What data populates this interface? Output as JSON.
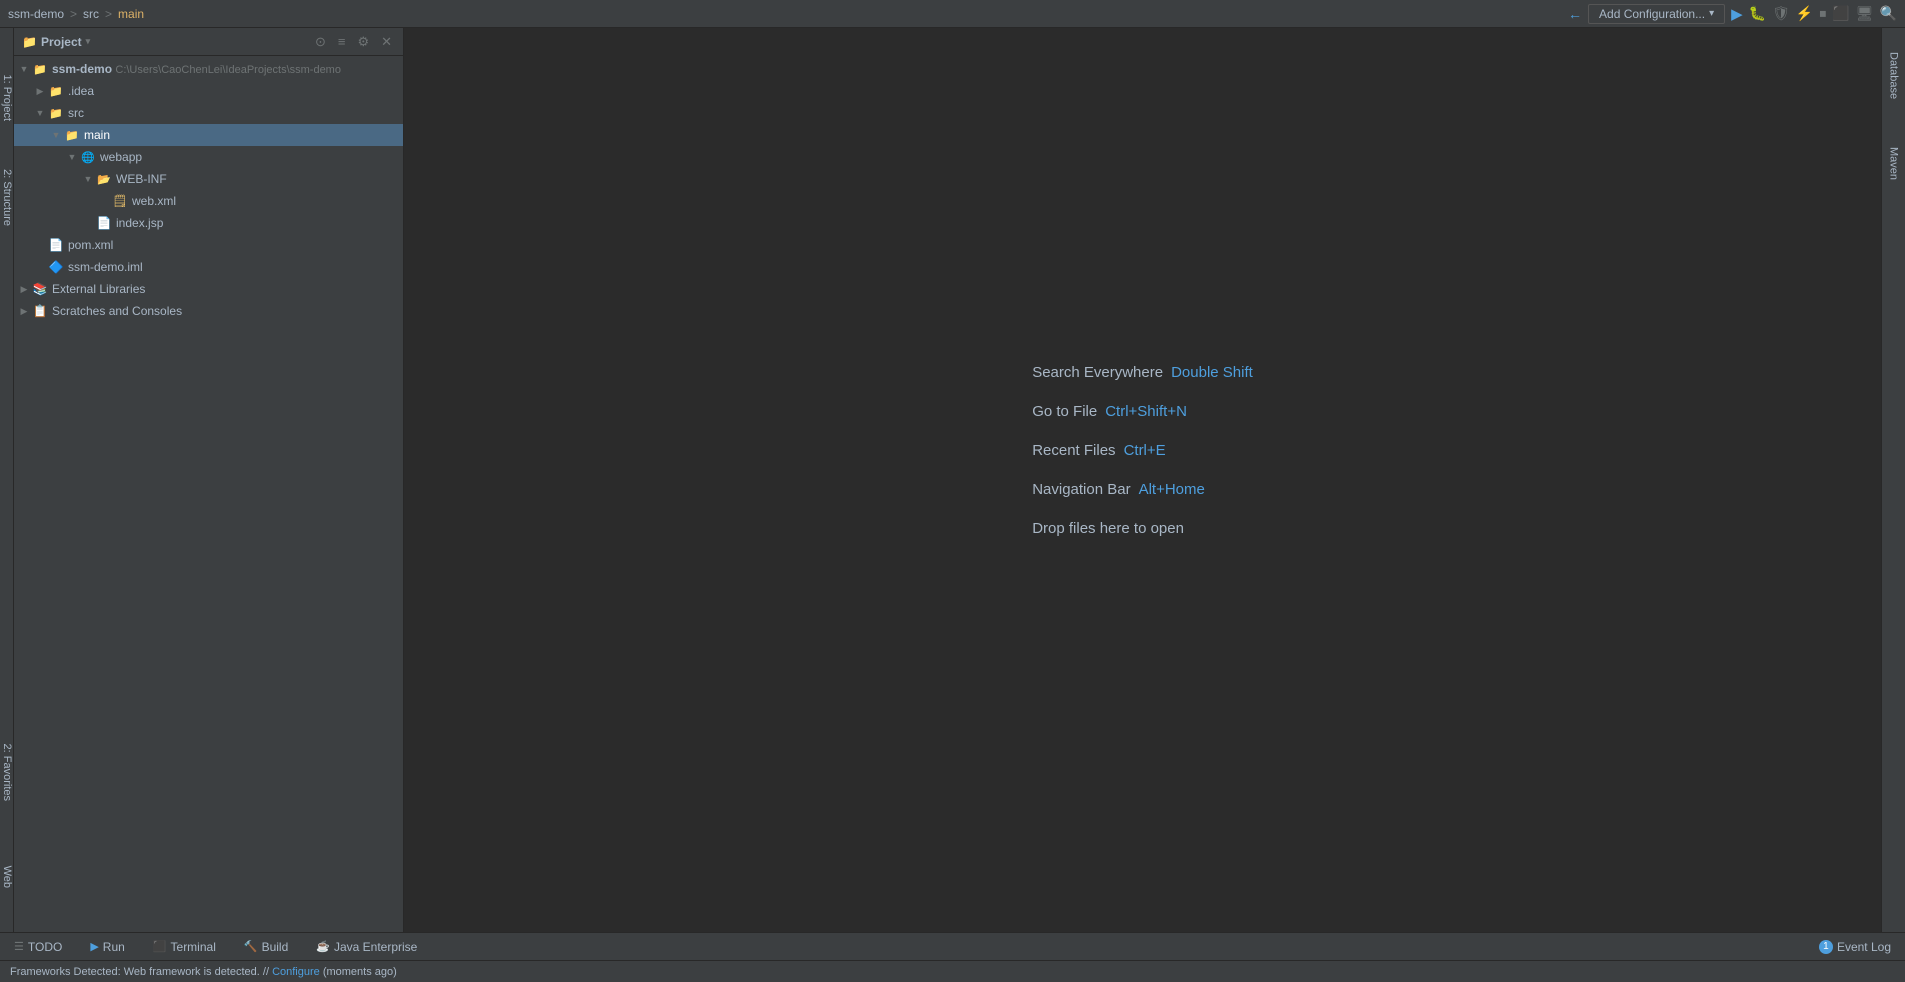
{
  "topbar": {
    "breadcrumb": {
      "project": "ssm-demo",
      "sep1": ">",
      "src": "src",
      "sep2": ">",
      "main": "main"
    },
    "addConfig": "Add Configuration...",
    "run_tooltip": "Run",
    "debug_tooltip": "Debug"
  },
  "sidebar": {
    "title": "Project",
    "leftTabs": [
      {
        "label": "1: Project",
        "id": "project-tab"
      },
      {
        "label": "2: Structure",
        "id": "structure-tab"
      },
      {
        "label": "2: Favorites",
        "id": "favorites-tab"
      }
    ],
    "tree": [
      {
        "id": "ssm-demo",
        "label": "ssm-demo",
        "path": "C:\\Users\\CaoChenLei\\IdeaProjects\\ssm-demo",
        "indent": 0,
        "type": "project",
        "expanded": true,
        "selected": false
      },
      {
        "id": "idea",
        "label": ".idea",
        "indent": 1,
        "type": "folder",
        "expanded": false,
        "selected": false
      },
      {
        "id": "src",
        "label": "src",
        "indent": 1,
        "type": "folder-src",
        "expanded": true,
        "selected": false
      },
      {
        "id": "main",
        "label": "main",
        "indent": 2,
        "type": "folder",
        "expanded": true,
        "selected": true
      },
      {
        "id": "webapp",
        "label": "webapp",
        "indent": 3,
        "type": "folder-web",
        "expanded": true,
        "selected": false
      },
      {
        "id": "web-inf",
        "label": "WEB-INF",
        "indent": 4,
        "type": "folder-web-inf",
        "expanded": true,
        "selected": false
      },
      {
        "id": "web-xml",
        "label": "web.xml",
        "indent": 5,
        "type": "xml",
        "selected": false
      },
      {
        "id": "index-jsp",
        "label": "index.jsp",
        "indent": 4,
        "type": "jsp",
        "selected": false
      },
      {
        "id": "pom-xml",
        "label": "pom.xml",
        "indent": 0,
        "type": "pom",
        "selected": false
      },
      {
        "id": "ssm-iml",
        "label": "ssm-demo.iml",
        "indent": 0,
        "type": "iml",
        "selected": false
      },
      {
        "id": "ext-libs",
        "label": "External Libraries",
        "indent": 0,
        "type": "library",
        "expanded": false,
        "selected": false
      },
      {
        "id": "scratches",
        "label": "Scratches and Consoles",
        "indent": 0,
        "type": "scratch",
        "expanded": false,
        "selected": false
      }
    ]
  },
  "main": {
    "welcome": [
      {
        "label": "Search Everywhere",
        "shortcut": "Double Shift"
      },
      {
        "label": "Go to File",
        "shortcut": "Ctrl+Shift+N"
      },
      {
        "label": "Recent Files",
        "shortcut": "Ctrl+E"
      },
      {
        "label": "Navigation Bar",
        "shortcut": "Alt+Home"
      }
    ],
    "dropText": "Drop files here to open"
  },
  "rightTabs": [
    {
      "label": "Database",
      "id": "database-tab"
    },
    {
      "label": "Maven",
      "id": "maven-tab"
    }
  ],
  "bottomTabs": [
    {
      "icon": "≡",
      "label": "TODO",
      "id": "todo-tab"
    },
    {
      "icon": "▶",
      "label": "Run",
      "id": "run-tab"
    },
    {
      "icon": "⬛",
      "label": "Terminal",
      "id": "terminal-tab"
    },
    {
      "icon": "🔨",
      "label": "Build",
      "id": "build-tab"
    },
    {
      "icon": "☕",
      "label": "Java Enterprise",
      "id": "java-enterprise-tab"
    }
  ],
  "statusBar": {
    "text": "Frameworks Detected: Web framework is detected. // Configure (moments ago)"
  },
  "eventLog": {
    "label": "Event Log",
    "count": "1"
  }
}
